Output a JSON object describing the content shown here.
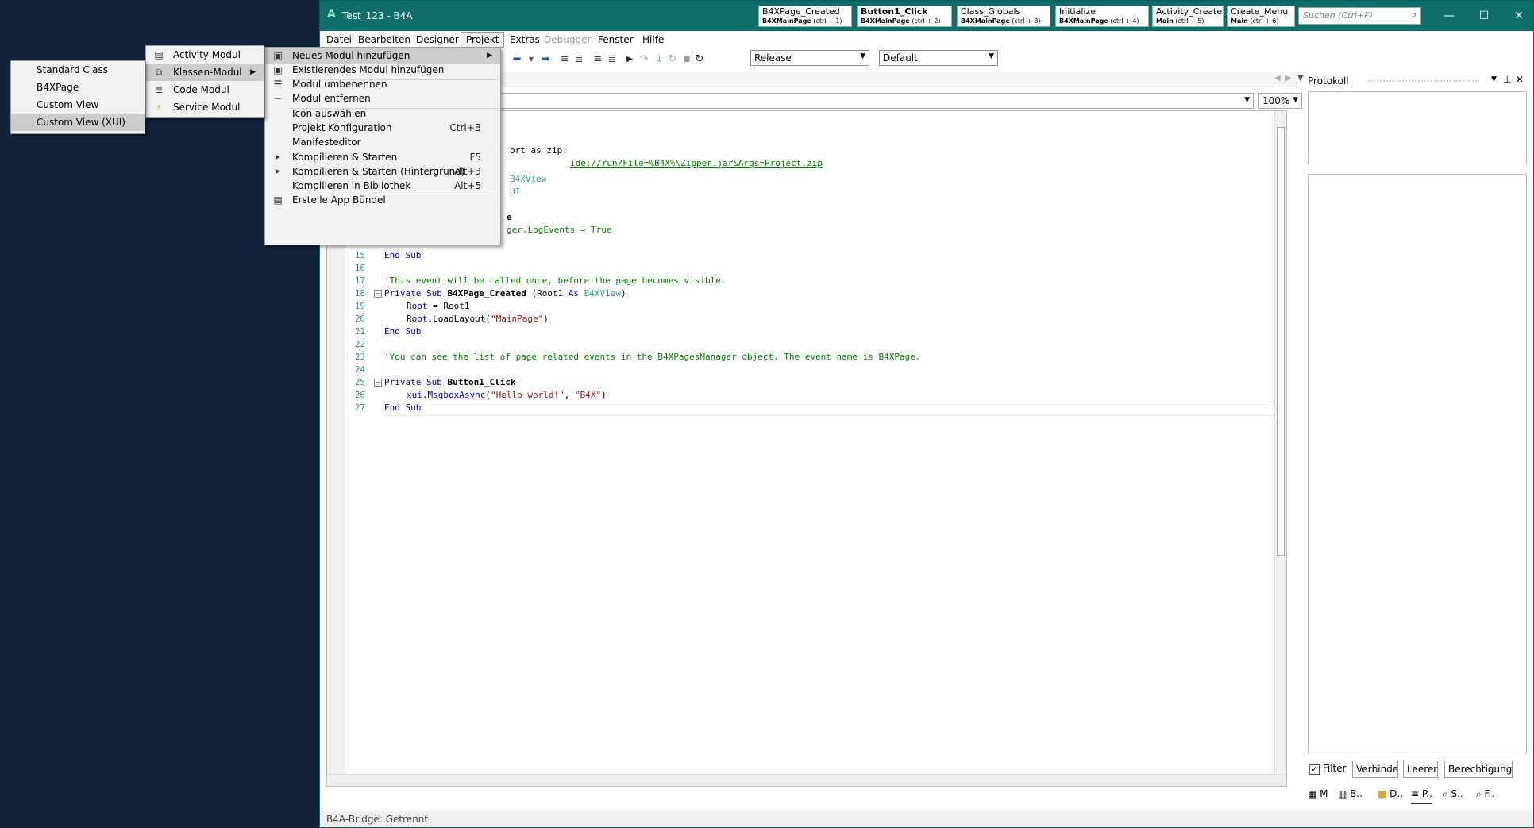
{
  "window": {
    "title": "Test_123 - B4A",
    "search_placeholder": "Suchen (Ctrl+F)",
    "quick_tabs": [
      {
        "name": "B4XPage_Created",
        "module": "B4XMainPage",
        "shortcut": "(ctrl + 1)",
        "active": false
      },
      {
        "name": "Button1_Click",
        "module": "B4XMainPage",
        "shortcut": "(ctrl + 2)",
        "active": true
      },
      {
        "name": "Class_Globals",
        "module": "B4XMainPage",
        "shortcut": "(ctrl + 3)",
        "active": false
      },
      {
        "name": "Initialize",
        "module": "B4XMainPage",
        "shortcut": "(ctrl + 4)",
        "active": false
      },
      {
        "name": "Activity_Create",
        "module": "Main",
        "shortcut": "(ctrl + 5)",
        "active": false
      },
      {
        "name": "Create_Menu",
        "module": "Main",
        "shortcut": "(ctrl + 6)",
        "active": false
      }
    ]
  },
  "menubar": [
    "Datei",
    "Bearbeiten",
    "Designer",
    "Projekt",
    "Extras",
    "Debuggen",
    "Fenster",
    "Hilfe"
  ],
  "toolbar": {
    "build_config": "Release",
    "build_target": "Default",
    "zoom": "100%"
  },
  "projekt_menu": [
    {
      "label": "Neues Modul hinzufügen",
      "shortcut": "",
      "icon": "new-module-icon",
      "submenu": true,
      "highlight": true
    },
    {
      "label": "Existierendes Modul hinzufügen",
      "shortcut": "",
      "icon": "existing-module-icon",
      "submenu": false
    },
    {
      "label": "Modul umbenennen",
      "shortcut": "",
      "icon": "rename-icon",
      "submenu": false
    },
    {
      "label": "Modul entfernen",
      "shortcut": "",
      "icon": "remove-icon",
      "submenu": false
    },
    {
      "label": "Icon auswählen",
      "shortcut": "",
      "icon": "",
      "submenu": false
    },
    {
      "label": "Projekt Konfiguration",
      "shortcut": "Ctrl+B",
      "icon": "",
      "submenu": false
    },
    {
      "label": "Manifesteditor",
      "shortcut": "",
      "icon": "",
      "submenu": false
    },
    {
      "label": "Kompilieren & Starten",
      "shortcut": "F5",
      "icon": "play-icon",
      "submenu": false
    },
    {
      "label": "Kompilieren & Starten (Hintergrund)",
      "shortcut": "Alt+3",
      "icon": "play-icon",
      "submenu": false
    },
    {
      "label": "Kompilieren in Bibliothek",
      "shortcut": "Alt+5",
      "icon": "",
      "submenu": false
    },
    {
      "label": "Erstelle App Bündel",
      "shortcut": "",
      "icon": "bundle-icon",
      "submenu": false
    }
  ],
  "module_menu": [
    {
      "label": "Activity Modul",
      "icon": "activity-icon",
      "submenu": false
    },
    {
      "label": "Klassen-Modul",
      "icon": "class-icon",
      "submenu": true,
      "highlight": true
    },
    {
      "label": "Code Modul",
      "icon": "code-icon",
      "submenu": false
    },
    {
      "label": "Service Modul",
      "icon": "service-icon",
      "submenu": false
    }
  ],
  "class_menu": [
    {
      "label": "Standard Class"
    },
    {
      "label": "B4XPage"
    },
    {
      "label": "Custom View"
    },
    {
      "label": "Custom View (XUI)",
      "highlight": true
    }
  ],
  "code": {
    "partial": [
      {
        "text": "ort as zip: ",
        "link": "ide://run?File=%B4X%\\Zipper.jar&Args=Project.zip"
      },
      {
        "text": "B4XView"
      },
      {
        "text": "UI"
      },
      {
        "text": "e"
      },
      {
        "text": "ger.LogEvents = True"
      }
    ],
    "lines": [
      {
        "n": "15",
        "text": "End Sub"
      },
      {
        "n": "16",
        "text": ""
      },
      {
        "n": "17",
        "text": "'This event will be called once, before the page becomes visible."
      },
      {
        "n": "18",
        "text": "Private Sub B4XPage_Created (Root1 As B4XView)"
      },
      {
        "n": "19",
        "text": "Root = Root1"
      },
      {
        "n": "20",
        "text": "Root.LoadLayout(\"MainPage\")"
      },
      {
        "n": "21",
        "text": "End Sub"
      },
      {
        "n": "22",
        "text": ""
      },
      {
        "n": "23",
        "text": "'You can see the list of page related events in the B4XPagesManager object. The event name is B4XPage."
      },
      {
        "n": "24",
        "text": ""
      },
      {
        "n": "25",
        "text": "Private Sub Button1_Click"
      },
      {
        "n": "26",
        "text": "xui.MsgboxAsync(\"Hello world!\", \"B4X\")"
      },
      {
        "n": "27",
        "text": "End Sub"
      }
    ]
  },
  "panel": {
    "title": "Protokoll",
    "filter_label": "Filter",
    "filter_checked": true,
    "buttons": [
      "Verbinden",
      "Leeren",
      "Berechtigungen"
    ],
    "tabs": [
      "M",
      "B..",
      "D..",
      "P..",
      "S..",
      "F.."
    ]
  },
  "statusbar": "B4A-Bridge: Getrennt"
}
